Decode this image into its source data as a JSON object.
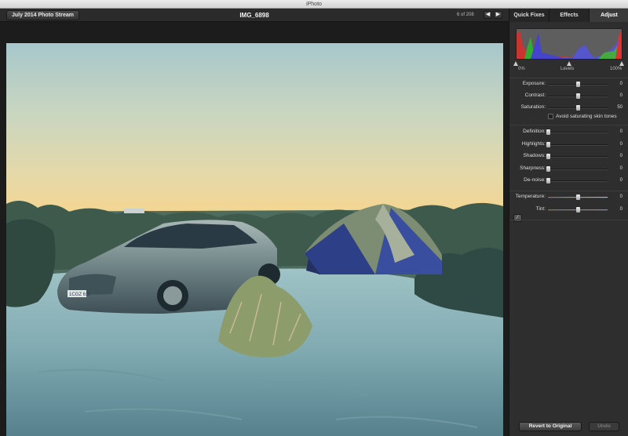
{
  "window": {
    "title": "iPhoto"
  },
  "toolbar": {
    "album_button": "July 2014 Photo Stream",
    "photo_title": "IMG_6898",
    "counter": "6 of 208",
    "prev_icon": "◀",
    "next_icon": "▶"
  },
  "panel": {
    "tabs": [
      {
        "label": "Quick Fixes",
        "active": false
      },
      {
        "label": "Effects",
        "active": false
      },
      {
        "label": "Adjust",
        "active": true
      }
    ],
    "levels": {
      "left": "0%",
      "center": "Levels",
      "right": "100%"
    },
    "sliders_group1": [
      {
        "label": "Exposure:",
        "value": "0",
        "fraction": 0.5
      },
      {
        "label": "Contrast:",
        "value": "0",
        "fraction": 0.5
      },
      {
        "label": "Saturation:",
        "value": "50",
        "fraction": 0.5
      }
    ],
    "checkbox": {
      "label": "Avoid saturating skin tones",
      "checked": false
    },
    "sliders_group2": [
      {
        "label": "Definition:",
        "value": "0",
        "fraction": 0.0
      },
      {
        "label": "Highlights:",
        "value": "0",
        "fraction": 0.0
      },
      {
        "label": "Shadows:",
        "value": "0",
        "fraction": 0.0
      },
      {
        "label": "Sharpness:",
        "value": "0",
        "fraction": 0.0
      },
      {
        "label": "De-noise:",
        "value": "0",
        "fraction": 0.0
      }
    ],
    "sliders_group3": [
      {
        "label": "Temperature:",
        "value": "0",
        "fraction": 0.5
      },
      {
        "label": "Tint:",
        "value": "0",
        "fraction": 0.5
      }
    ],
    "revert_button": "Revert to Original",
    "undo_button": "Undo"
  },
  "photo": {
    "plate_text": "1CGZ 611"
  },
  "colors": {
    "panel_bg": "#2e2e2e",
    "temperature_gradient": [
      "#3a7fd0",
      "#d8c040"
    ],
    "tint_gradient": [
      "#c040c0",
      "#40c040"
    ]
  }
}
